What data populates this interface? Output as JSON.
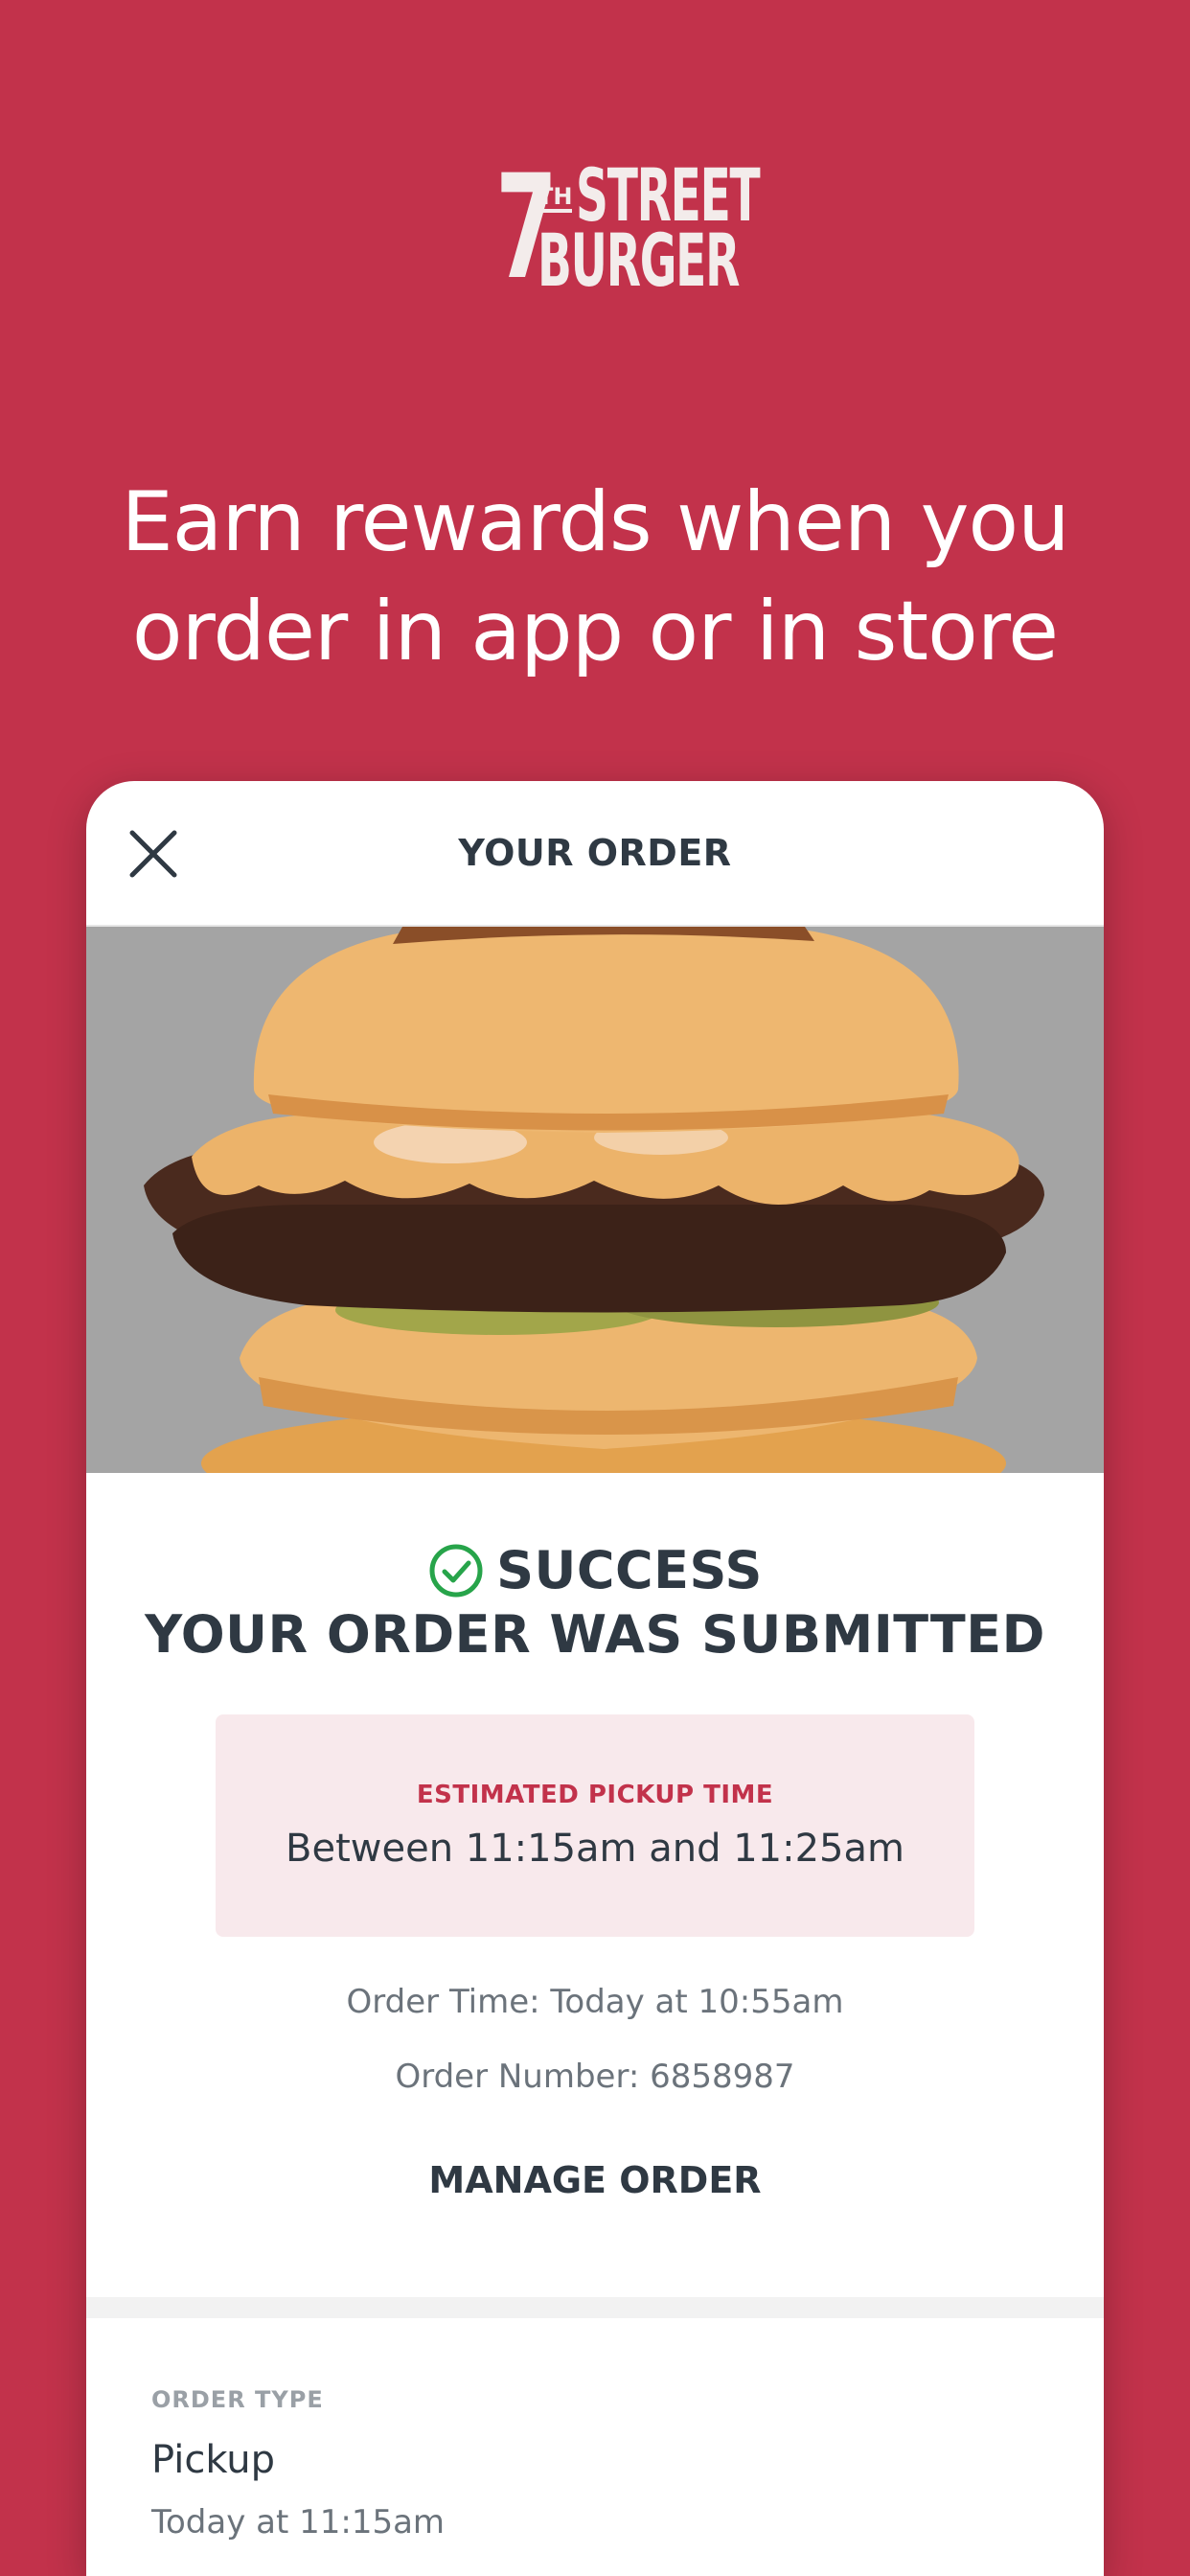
{
  "brand": {
    "logo_seven": "7",
    "logo_th": "TH",
    "logo_street": "STREET",
    "logo_burger": "BURGER",
    "background_color": "#c2324b"
  },
  "headline": {
    "line1": "Earn rewards when you",
    "line2": "order in app or in store"
  },
  "card": {
    "title": "YOUR ORDER",
    "close_icon": "close-icon",
    "success_label": "SUCCESS",
    "submitted_label": "YOUR ORDER WAS SUBMITTED",
    "check_icon": "check-circle-icon",
    "pickup": {
      "label": "ESTIMATED PICKUP TIME",
      "value": "Between 11:15am and 11:25am"
    },
    "order_time": "Order Time: Today at 10:55am",
    "order_number": "Order Number: 6858987",
    "manage_label": "MANAGE ORDER",
    "order_type": {
      "label": "ORDER TYPE",
      "value": "Pickup",
      "time": "Today at 11:15am"
    }
  },
  "colors": {
    "accent": "#c2324b",
    "success_green": "#27a44a",
    "text_dark": "#2f3943",
    "pickup_bg": "#f8e9ec"
  }
}
